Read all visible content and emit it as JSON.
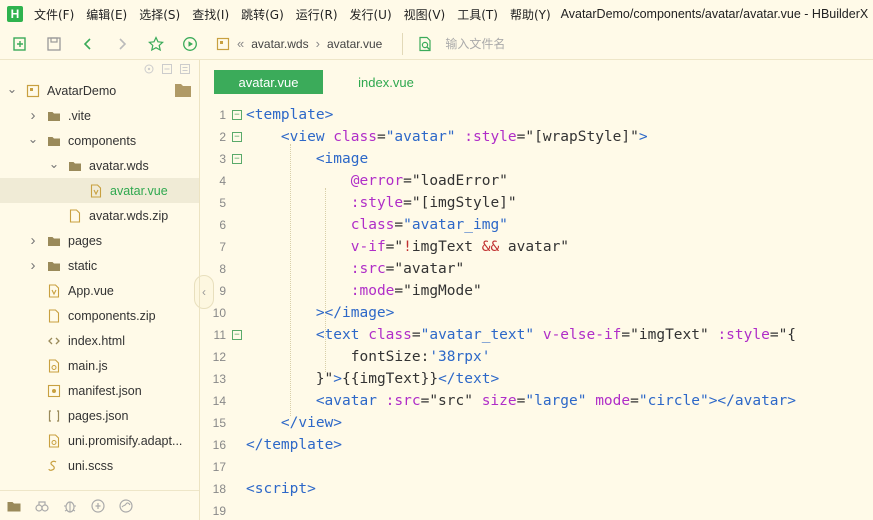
{
  "app": {
    "logo_letter": "H",
    "menu": [
      "文件(F)",
      "编辑(E)",
      "选择(S)",
      "查找(I)",
      "跳转(G)",
      "运行(R)",
      "发行(U)",
      "视图(V)",
      "工具(T)",
      "帮助(Y)"
    ],
    "window_title": "AvatarDemo/components/avatar/avatar.vue - HBuilderX"
  },
  "toolbar": {
    "breadcrumb": [
      "avatar.wds",
      "avatar.vue"
    ],
    "breadcrumb_prefix": "«",
    "search_placeholder": "输入文件名"
  },
  "sidebar": {
    "items": [
      {
        "label": "AvatarDemo",
        "level": 0,
        "expanded": true,
        "icon": "project-icon"
      },
      {
        "label": ".vite",
        "level": 1,
        "expanded": false,
        "icon": "folder-icon"
      },
      {
        "label": "components",
        "level": 1,
        "expanded": true,
        "icon": "folder-icon"
      },
      {
        "label": "avatar.wds",
        "level": 2,
        "expanded": true,
        "icon": "folder-icon"
      },
      {
        "label": "avatar.vue",
        "level": 3,
        "icon": "vue-file-icon",
        "selected": true
      },
      {
        "label": "avatar.wds.zip",
        "level": 2,
        "icon": "file-icon"
      },
      {
        "label": "pages",
        "level": 1,
        "expanded": false,
        "icon": "folder-icon"
      },
      {
        "label": "static",
        "level": 1,
        "expanded": false,
        "icon": "folder-icon"
      },
      {
        "label": "App.vue",
        "level": 1,
        "icon": "vue-file-icon"
      },
      {
        "label": "components.zip",
        "level": 1,
        "icon": "file-icon"
      },
      {
        "label": "index.html",
        "level": 1,
        "icon": "html-file-icon"
      },
      {
        "label": "main.js",
        "level": 1,
        "icon": "js-file-icon"
      },
      {
        "label": "manifest.json",
        "level": 1,
        "icon": "manifest-file-icon"
      },
      {
        "label": "pages.json",
        "level": 1,
        "icon": "json-file-icon"
      },
      {
        "label": "uni.promisify.adapt...",
        "level": 1,
        "icon": "js-file-icon"
      },
      {
        "label": "uni.scss",
        "level": 1,
        "icon": "scss-file-icon"
      }
    ]
  },
  "tabs": [
    {
      "label": "avatar.vue",
      "active": true
    },
    {
      "label": "index.vue",
      "active": false
    }
  ],
  "code_lines": [
    {
      "n": "1",
      "fold": true,
      "indent": 0,
      "tokens": [
        [
          "tag",
          "<template>"
        ]
      ]
    },
    {
      "n": "2",
      "fold": true,
      "indent": 1,
      "tokens": [
        [
          "tag",
          "<view "
        ],
        [
          "attr",
          "class"
        ],
        [
          "str",
          "="
        ],
        [
          "tag",
          "\"avatar\""
        ],
        [
          "str",
          " "
        ],
        [
          "attr",
          ":style"
        ],
        [
          "str",
          "=\"[wrapStyle]\""
        ],
        [
          "tag",
          ">"
        ]
      ]
    },
    {
      "n": "3",
      "fold": true,
      "indent": 2,
      "tokens": [
        [
          "tag",
          "<image"
        ]
      ]
    },
    {
      "n": "4",
      "fold": false,
      "indent": 3,
      "tokens": [
        [
          "attr",
          "@error"
        ],
        [
          "str",
          "=\"loadError\""
        ]
      ]
    },
    {
      "n": "5",
      "fold": false,
      "indent": 3,
      "tokens": [
        [
          "attr",
          ":style"
        ],
        [
          "str",
          "=\"[imgStyle]\""
        ]
      ]
    },
    {
      "n": "6",
      "fold": false,
      "indent": 3,
      "tokens": [
        [
          "attr",
          "class"
        ],
        [
          "str",
          "="
        ],
        [
          "tag",
          "\"avatar_img\""
        ]
      ]
    },
    {
      "n": "7",
      "fold": false,
      "indent": 3,
      "tokens": [
        [
          "attr",
          "v-if"
        ],
        [
          "str",
          "=\""
        ],
        [
          "kw",
          "!"
        ],
        [
          "str",
          "imgText "
        ],
        [
          "kw",
          "&&"
        ],
        [
          "str",
          " avatar\""
        ]
      ]
    },
    {
      "n": "8",
      "fold": false,
      "indent": 3,
      "tokens": [
        [
          "attr",
          ":src"
        ],
        [
          "str",
          "=\"avatar\""
        ]
      ]
    },
    {
      "n": "9",
      "fold": false,
      "indent": 3,
      "tokens": [
        [
          "attr",
          ":mode"
        ],
        [
          "str",
          "=\"imgMode\""
        ]
      ]
    },
    {
      "n": "10",
      "fold": false,
      "indent": 2,
      "tokens": [
        [
          "tag",
          "></image>"
        ]
      ]
    },
    {
      "n": "11",
      "fold": true,
      "indent": 2,
      "tokens": [
        [
          "tag",
          "<text "
        ],
        [
          "attr",
          "class"
        ],
        [
          "str",
          "="
        ],
        [
          "tag",
          "\"avatar_text\""
        ],
        [
          "str",
          " "
        ],
        [
          "attr",
          "v-else-if"
        ],
        [
          "str",
          "=\"imgText\" "
        ],
        [
          "attr",
          ":style"
        ],
        [
          "str",
          "=\"{"
        ]
      ]
    },
    {
      "n": "12",
      "fold": false,
      "indent": 3,
      "tokens": [
        [
          "str",
          "fontSize:"
        ],
        [
          "tag",
          "'38rpx'"
        ]
      ]
    },
    {
      "n": "13",
      "fold": false,
      "indent": 2,
      "tokens": [
        [
          "str",
          "}\""
        ],
        [
          "tag",
          ">"
        ],
        [
          "str",
          "{{imgText}}"
        ],
        [
          "tag",
          "</text>"
        ]
      ]
    },
    {
      "n": "14",
      "fold": false,
      "indent": 2,
      "tokens": [
        [
          "tag",
          "<avatar "
        ],
        [
          "attr",
          ":src"
        ],
        [
          "str",
          "=\"src\" "
        ],
        [
          "attr",
          "size"
        ],
        [
          "str",
          "="
        ],
        [
          "tag",
          "\"large\""
        ],
        [
          "str",
          " "
        ],
        [
          "attr",
          "mode"
        ],
        [
          "str",
          "="
        ],
        [
          "tag",
          "\"circle\""
        ],
        [
          "tag",
          "></avatar>"
        ]
      ]
    },
    {
      "n": "15",
      "fold": false,
      "indent": 1,
      "tokens": [
        [
          "tag",
          "</view>"
        ]
      ]
    },
    {
      "n": "16",
      "fold": false,
      "indent": 0,
      "tokens": [
        [
          "tag",
          "</template>"
        ]
      ]
    },
    {
      "n": "17",
      "fold": false,
      "indent": 0,
      "tokens": []
    },
    {
      "n": "18",
      "fold": false,
      "indent": 0,
      "tokens": [
        [
          "tag",
          "<script>"
        ]
      ]
    },
    {
      "n": "19",
      "fold": false,
      "indent": 0,
      "tokens": []
    }
  ],
  "colors": {
    "accent_green": "#3bab5a",
    "background": "#fffae8",
    "tag_blue": "#2d68c8",
    "attr_purple": "#b02ec8",
    "keyword_red": "#c03030"
  }
}
